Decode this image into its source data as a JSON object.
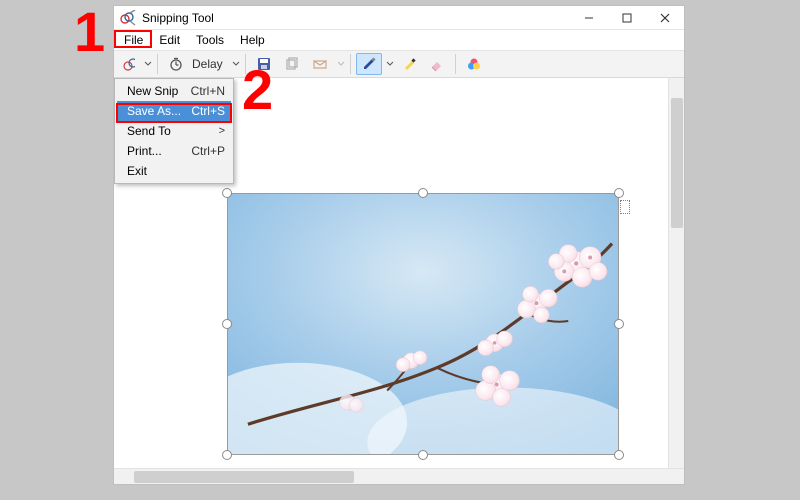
{
  "window": {
    "title": "Snipping Tool"
  },
  "menubar": {
    "file": "File",
    "edit": "Edit",
    "tools": "Tools",
    "help": "Help"
  },
  "file_menu": {
    "new_snip": {
      "label": "New Snip",
      "shortcut": "Ctrl+N"
    },
    "save_as": {
      "label": "Save As...",
      "shortcut": "Ctrl+S"
    },
    "send_to": {
      "label": "Send To",
      "submenu_indicator": ">"
    },
    "print": {
      "label": "Print...",
      "shortcut": "Ctrl+P"
    },
    "exit": {
      "label": "Exit"
    }
  },
  "toolbar": {
    "delay_label": "Delay"
  },
  "annotations": {
    "step1": "1",
    "step2": "2"
  },
  "colors": {
    "annotation_red": "#ff0000",
    "highlight_blue": "#4a90d9",
    "pen_active_bg": "#cfe6ff"
  }
}
